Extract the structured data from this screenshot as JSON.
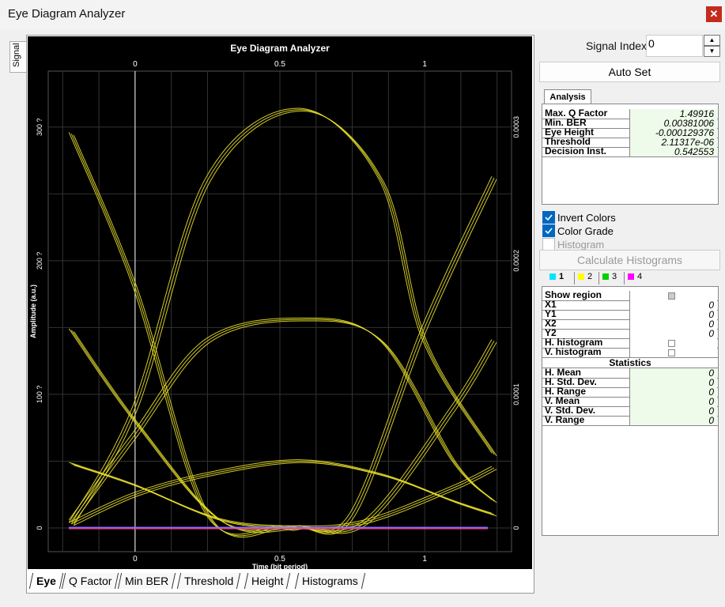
{
  "window": {
    "title": "Eye Diagram Analyzer",
    "close_icon": "close-icon"
  },
  "side_tab": {
    "label": "Signal"
  },
  "plot": {
    "title": "Eye Diagram Analyzer",
    "xlabel": "Time (bit period)",
    "ylabel": "Amplitude (a.u.)",
    "x_ticks": [
      "0",
      "0.5",
      "1"
    ],
    "y_left_ticks": [
      "0",
      "100 ?",
      "200 ?",
      "300 ?"
    ],
    "y_right_ticks": [
      "0",
      "0.0001",
      "0.0002",
      "0.0003"
    ]
  },
  "chart_data": {
    "type": "line",
    "title": "Eye Diagram Analyzer",
    "xlabel": "Time (bit period)",
    "ylabel": "Amplitude (a.u.)",
    "xlim": [
      -0.3,
      1.3
    ],
    "ylim": [
      0,
      0.00033
    ],
    "grid": true,
    "colors": {
      "trace": "#e9e02a",
      "background": "#000000",
      "axis": "#ffffff"
    },
    "series": [
      {
        "x": [
          -0.22,
          0,
          0.25,
          0.5,
          0.57,
          0.75,
          1,
          1.24
        ],
        "y": [
          0.000295,
          0.00018,
          1e-05,
          5e-07,
          5e-07,
          1e-05,
          0.00015,
          0.000262
        ]
      },
      {
        "x": [
          -0.22,
          0,
          0.25,
          0.57,
          0.85,
          1,
          1.24
        ],
        "y": [
          3e-06,
          9e-05,
          0.00026,
          0.000313,
          0.00026,
          0.00014,
          5.5e-05
        ]
      },
      {
        "x": [
          -0.22,
          0,
          0.25,
          0.57,
          0.85,
          1.1,
          1.24
        ],
        "y": [
          5e-06,
          7e-05,
          0.00014,
          0.000156,
          0.00014,
          5e-05,
          2e-05
        ]
      },
      {
        "x": [
          -0.22,
          0,
          0.3,
          0.57,
          0.8,
          1.1,
          1.24
        ],
        "y": [
          0.000148,
          8e-05,
          5e-06,
          5e-07,
          5e-06,
          9e-05,
          0.00014
        ]
      },
      {
        "x": [
          -0.22,
          0,
          0.25,
          0.57,
          0.85,
          1.1,
          1.24
        ],
        "y": [
          3e-06,
          2.5e-05,
          4e-05,
          5e-05,
          4e-05,
          2e-05,
          1e-05
        ]
      },
      {
        "x": [
          -0.22,
          0,
          0.3,
          0.57,
          0.8,
          1.1,
          1.24
        ],
        "y": [
          4.8e-05,
          3.2e-05,
          6e-06,
          5e-07,
          5e-06,
          3e-05,
          4.5e-05
        ]
      }
    ]
  },
  "bottom_tabs": [
    "Eye",
    "Q Factor",
    "Min BER",
    "Threshold",
    "Height",
    "Histograms"
  ],
  "right_panel": {
    "signal_index_label": "Signal Index:",
    "signal_index_value": "0",
    "auto_set_label": "Auto Set",
    "analysis_tab": "Analysis",
    "analysis": [
      {
        "key": "Max. Q Factor",
        "value": "1.49916"
      },
      {
        "key": "Min. BER",
        "value": "0.00381006"
      },
      {
        "key": "Eye Height",
        "value": "-0.000129376"
      },
      {
        "key": "Threshold",
        "value": "2.11317e-06"
      },
      {
        "key": "Decision Inst.",
        "value": "0.542553"
      }
    ],
    "invert_colors_label": "Invert Colors",
    "invert_colors_checked": true,
    "color_grade_label": "Color Grade",
    "color_grade_checked": true,
    "histogram_label": "Histogram",
    "histogram_checked": false,
    "calc_histograms_label": "Calculate Histograms",
    "region_tabs": [
      {
        "label": "1",
        "color": "#00e5ff"
      },
      {
        "label": "2",
        "color": "#ffff00"
      },
      {
        "label": "3",
        "color": "#00d000"
      },
      {
        "label": "4",
        "color": "#ff00ff"
      }
    ],
    "region_rows": [
      {
        "key": "Show region",
        "value": ""
      },
      {
        "key": "X1",
        "value": "0"
      },
      {
        "key": "Y1",
        "value": "0"
      },
      {
        "key": "X2",
        "value": "0"
      },
      {
        "key": "Y2",
        "value": "0"
      },
      {
        "key": "H. histogram",
        "value": ""
      },
      {
        "key": "V. histogram",
        "value": ""
      }
    ],
    "statistics_label": "Statistics",
    "stats": [
      {
        "key": "H. Mean",
        "value": "0"
      },
      {
        "key": "H. Std. Dev.",
        "value": "0"
      },
      {
        "key": "H. Range",
        "value": "0"
      },
      {
        "key": "V. Mean",
        "value": "0"
      },
      {
        "key": "V. Std. Dev.",
        "value": "0"
      },
      {
        "key": "V. Range",
        "value": "0"
      }
    ]
  }
}
